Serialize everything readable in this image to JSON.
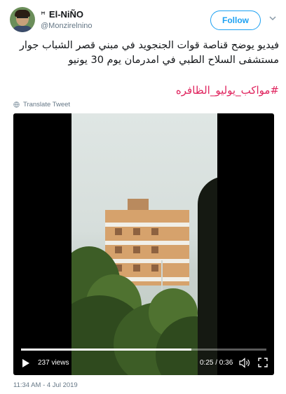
{
  "user": {
    "display_name": "El-NiÑO",
    "name_prefix_glyph": "ꟸ",
    "handle": "@Monzirelnino"
  },
  "follow_label": "Follow",
  "tweet_text": "فيديو يوضح قناصة قوات الجنجويد في مبني قصر الشباب جوار مستشفى السلاح الطبي في امدرمان يوم 30 يونيو",
  "hashtag": "#مواكب_يوليو_الظافره",
  "translate_label": "Translate Tweet",
  "video": {
    "views": "237 views",
    "time": "0:25 / 0:36",
    "progress": 0.694
  },
  "timestamp": "11:34 AM - 4 Jul 2019",
  "colors": {
    "accent": "#1da1f2",
    "hashtag": "#e0245e",
    "secondary_text": "#657786"
  },
  "icons": [
    "chevron-down-icon",
    "globe-icon",
    "play-icon",
    "volume-icon",
    "fullscreen-icon"
  ]
}
